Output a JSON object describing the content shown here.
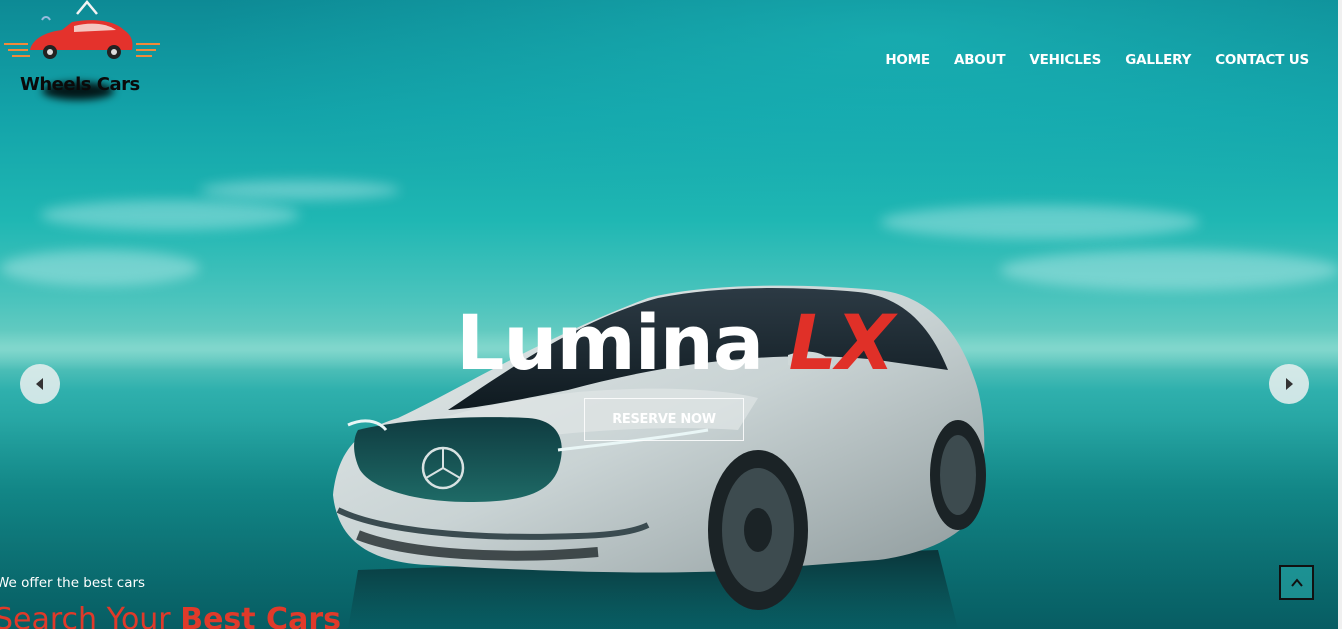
{
  "brand": {
    "name": "Wheels Cars",
    "logo_icon": "car-logo-icon"
  },
  "nav": {
    "items": [
      {
        "label": "HOME"
      },
      {
        "label": "ABOUT"
      },
      {
        "label": "VEHICLES"
      },
      {
        "label": "GALLERY"
      },
      {
        "label": "CONTACT US"
      }
    ]
  },
  "hero": {
    "title_main": "Lumina",
    "title_accent": "LX",
    "cta_label": "RESERVE NOW",
    "prev_icon": "caret-left-icon",
    "next_icon": "caret-right-icon"
  },
  "intro": {
    "tagline": "We offer the best cars",
    "heading_prefix": "Search Your",
    "heading_strong": "Best Cars"
  },
  "scroll_top": {
    "icon": "chevron-up-icon"
  },
  "colors": {
    "accent": "#e03028",
    "nav_text": "#ffffff",
    "sky": "#13a3a9"
  }
}
